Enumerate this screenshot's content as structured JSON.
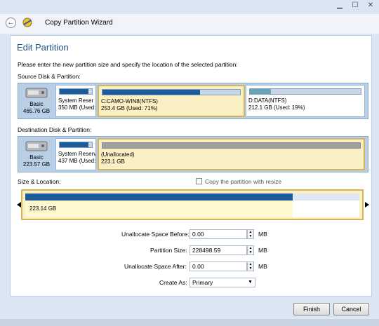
{
  "window": {
    "title": "Copy Partition Wizard",
    "controls": [
      "minimize-icon",
      "maximize-icon",
      "close-icon"
    ]
  },
  "page": {
    "title": "Edit Partition",
    "instruction": "Please enter the new partition size and specify the location of the selected partition:"
  },
  "source": {
    "label": "Source Disk & Partition:",
    "disk": {
      "type": "Basic",
      "size": "465.76 GB"
    },
    "partitions": [
      {
        "name": "System Reser",
        "info": "350 MB (Used:",
        "used_fraction": 0.9
      },
      {
        "name": "C:CAMO-WIN8(NTFS)",
        "info": "253.4 GB (Used: 71%)",
        "used_fraction": 0.71,
        "selected": true
      },
      {
        "name": "D:DATA(NTFS)",
        "info": "212.1 GB (Used: 19%)",
        "used_fraction": 0.19
      }
    ]
  },
  "destination": {
    "label": "Destination Disk & Partition:",
    "disk": {
      "type": "Basic",
      "size": "223.57 GB"
    },
    "partitions": [
      {
        "name": "System Reserv",
        "info": "437 MB (Used:",
        "used_fraction": 0.9
      },
      {
        "name": "(Unallocated)",
        "info": "223.1 GB",
        "used_fraction": 0.0,
        "selected": true
      }
    ]
  },
  "size_location": {
    "label": "Size & Location:",
    "copy_resize_label": "Copy the partition with resize",
    "bar_value": "223.14 GB",
    "partition_fraction": 0.8
  },
  "form": {
    "before_label": "Unallocate Space Before:",
    "before_value": "0.00",
    "before_unit": "MB",
    "size_label": "Partition Size:",
    "size_value": "228498.59",
    "size_unit": "MB",
    "after_label": "Unallocate Space After:",
    "after_value": "0.00",
    "after_unit": "MB",
    "create_label": "Create As:",
    "create_value": "Primary"
  },
  "buttons": {
    "finish": "Finish",
    "cancel": "Cancel"
  }
}
